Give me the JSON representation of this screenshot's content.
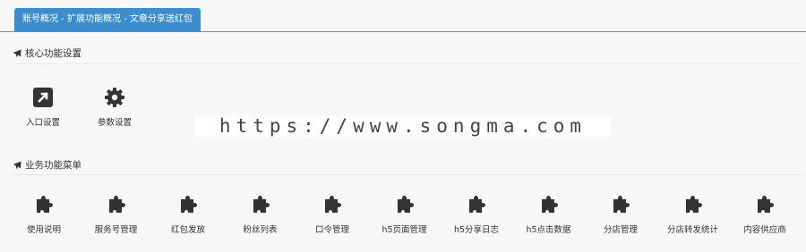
{
  "tab": {
    "label": "账号概况 - 扩展功能概况 - 文章分享送红包"
  },
  "sections": [
    {
      "title": "核心功能设置",
      "items": [
        {
          "label": "入口设置",
          "icon": "external-link-icon"
        },
        {
          "label": "参数设置",
          "icon": "gear-icon"
        }
      ]
    },
    {
      "title": "业务功能菜单",
      "items": [
        {
          "label": "使用说明",
          "icon": "puzzle-icon"
        },
        {
          "label": "服务号管理",
          "icon": "puzzle-icon"
        },
        {
          "label": "红包发放",
          "icon": "puzzle-icon"
        },
        {
          "label": "粉丝列表",
          "icon": "puzzle-icon"
        },
        {
          "label": "口令管理",
          "icon": "puzzle-icon"
        },
        {
          "label": "h5页面管理",
          "icon": "puzzle-icon"
        },
        {
          "label": "h5分享日志",
          "icon": "puzzle-icon"
        },
        {
          "label": "h5点击数据",
          "icon": "puzzle-icon"
        },
        {
          "label": "分店管理",
          "icon": "puzzle-icon"
        },
        {
          "label": "分店转发统计",
          "icon": "puzzle-icon"
        },
        {
          "label": "内容供应商",
          "icon": "puzzle-icon"
        }
      ]
    }
  ],
  "watermark": "https://www.songma.com",
  "colors": {
    "tab_bg": "#3c8dcf",
    "icon": "#333333"
  }
}
